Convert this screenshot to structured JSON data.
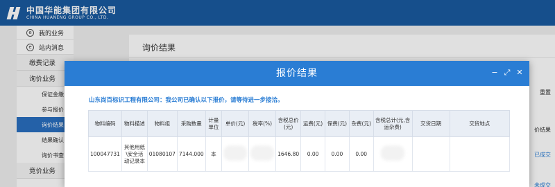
{
  "header": {
    "company_cn": "中国华能集团有限公司",
    "company_en": "CHINA HUANENG GROUP CO., LTD."
  },
  "sidebar": {
    "items": [
      {
        "label": "我的业务",
        "icon": "circle-e-icon"
      },
      {
        "label": "站内消息",
        "icon": "circle-e-icon"
      }
    ],
    "groups": [
      {
        "label": "缴费记录"
      },
      {
        "label": "询价业务"
      }
    ],
    "subitems": [
      "保证金缴",
      "参与报价",
      "询价结果",
      "结果确认",
      "询价书查"
    ],
    "last_group": "竞价业务"
  },
  "content": {
    "title": "询价结果",
    "right_peek": [
      "重置",
      "价结果",
      "已成交",
      "未成交"
    ]
  },
  "modal": {
    "title": "报价结果",
    "controls": [
      "minimize-icon",
      "maximize-icon",
      "close-icon"
    ],
    "message": "山东尚百标识工程有限公司：我公司已确认以下报价，请等待进一步接洽。",
    "table": {
      "headers": [
        "物料编码",
        "物料描述",
        "物料组",
        "采购数量",
        "计量单位",
        "单价(元)",
        "税率(%)",
        "含税总价(元)",
        "运费(元)",
        "保费(元)",
        "杂费(元)",
        "含税总计(元,含运杂费)",
        "交货日期",
        "交货地点"
      ],
      "rows": [
        [
          "100047731",
          "其他用纸\\安全活动记录本",
          "01080107",
          "7144.000",
          "本",
          "",
          "",
          "1646.80",
          "0.00",
          "0.00",
          "0.00",
          "",
          "",
          ""
        ]
      ]
    }
  }
}
